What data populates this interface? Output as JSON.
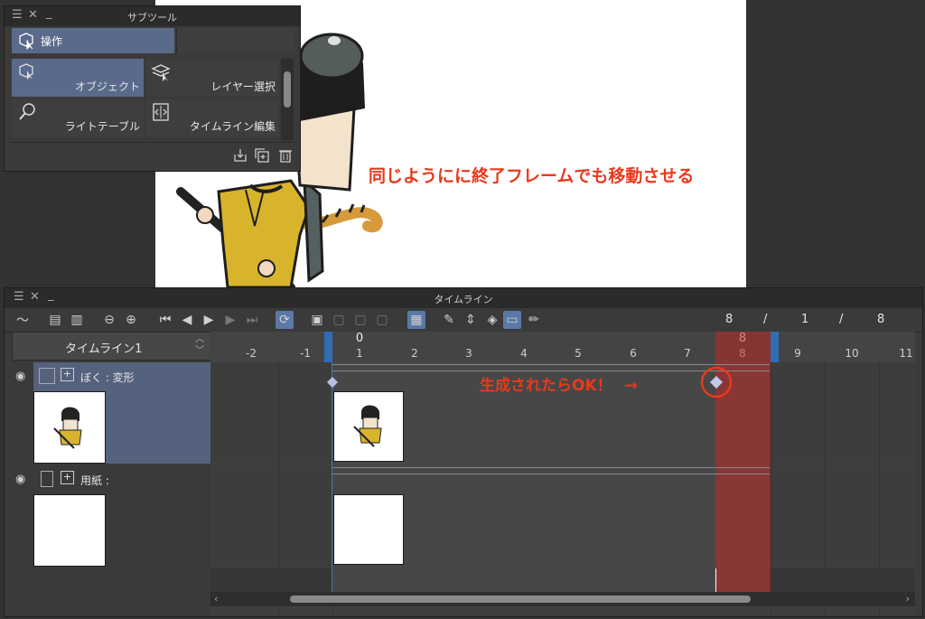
{
  "canvas": {
    "annotation": "同じようにに終了フレームでも移動させる"
  },
  "subtool_panel": {
    "title": "サブツール",
    "group_label": "操作",
    "tools": [
      {
        "label": "オブジェクト",
        "selected": true,
        "icon": "object-cursor-icon"
      },
      {
        "label": "レイヤー選択",
        "selected": false,
        "icon": "layer-select-icon"
      },
      {
        "label": "ライトテーブル",
        "selected": false,
        "icon": "light-table-icon"
      },
      {
        "label": "タイムライン編集",
        "selected": false,
        "icon": "timeline-edit-icon"
      }
    ]
  },
  "timeline_panel": {
    "title": "タイムライン",
    "frame_counter": {
      "current": "8",
      "sep1": "/",
      "start": "1",
      "sep2": "/",
      "end": "8"
    },
    "timeline_name": "タイムライン1",
    "layers": [
      {
        "label": "ぼく : 変形"
      },
      {
        "label": "用紙 :"
      }
    ],
    "ruler_top": {
      "zero": "0",
      "current": "8"
    },
    "ruler_ticks": [
      "-2",
      "-1",
      "1",
      "2",
      "3",
      "4",
      "5",
      "6",
      "7",
      "8",
      "9",
      "10",
      "11"
    ],
    "annotation": "生成されたらOK！",
    "arrow": "→"
  },
  "colors": {
    "accent_red": "#e8391d",
    "selection_blue": "#5a6a8a",
    "playhead_red": "#b83232",
    "marker_blue": "#2f6db5",
    "keyframe": "#b9bde6"
  }
}
